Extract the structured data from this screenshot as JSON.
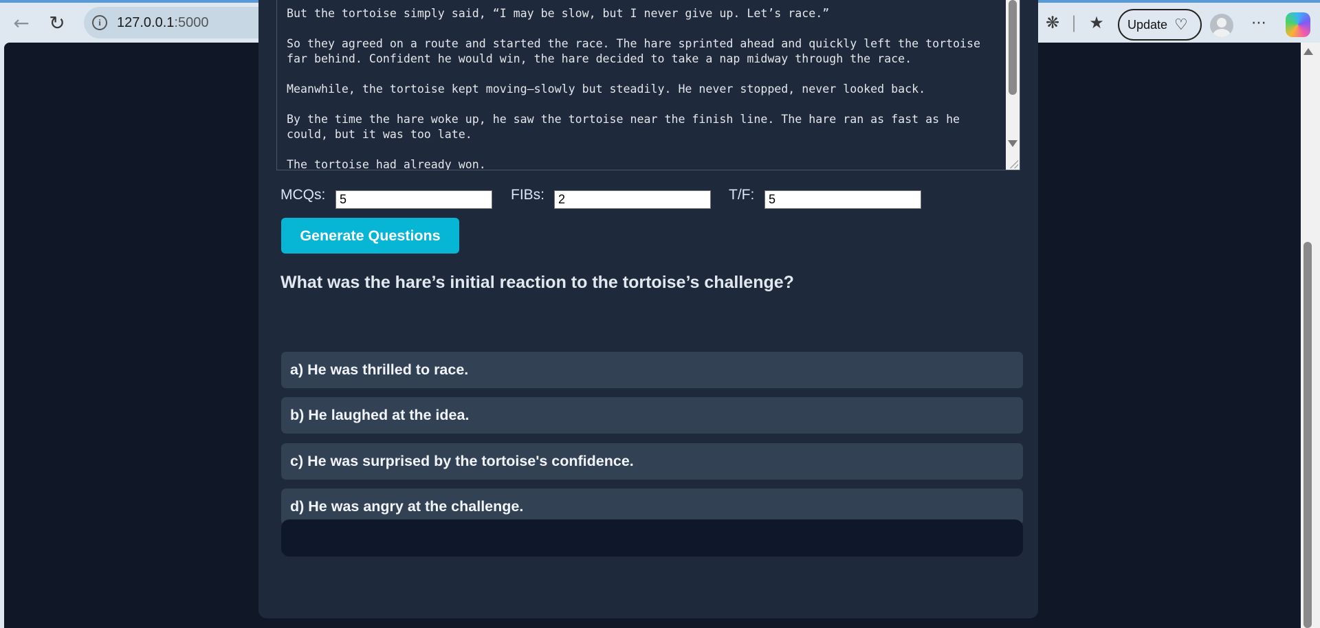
{
  "browser": {
    "url_host": "127.0.0.1",
    "url_port": ":5000",
    "update_label": "Update"
  },
  "story": {
    "text": "But the tortoise simply said, “I may be slow, but I never give up. Let’s race.”\n\nSo they agreed on a route and started the race. The hare sprinted ahead and quickly left the tortoise\nfar behind. Confident he would win, the hare decided to take a nap midway through the race.\n\nMeanwhile, the tortoise kept moving—slowly but steadily. He never stopped, never looked back.\n\nBy the time the hare woke up, he saw the tortoise near the finish line. The hare ran as fast as he\ncould, but it was too late.\n\nThe tortoise had already won."
  },
  "counts": {
    "mcq_label": "MCQs:",
    "mcq_value": "5",
    "fib_label": "FIBs:",
    "fib_value": "2",
    "tf_label": "T/F:",
    "tf_value": "5"
  },
  "generate_label": "Generate Questions",
  "quiz": {
    "question": "What was the hare’s initial reaction to the tortoise’s challenge?",
    "options": [
      "a) He was thrilled to race.",
      "b) He laughed at the idea.",
      "c) He was surprised by the tortoise's confidence.",
      "d) He was angry at the challenge."
    ]
  },
  "colors": {
    "page_bg": "#101827",
    "card_bg": "#1e293b",
    "accent": "#06b6d4",
    "option_bg": "#334155"
  }
}
